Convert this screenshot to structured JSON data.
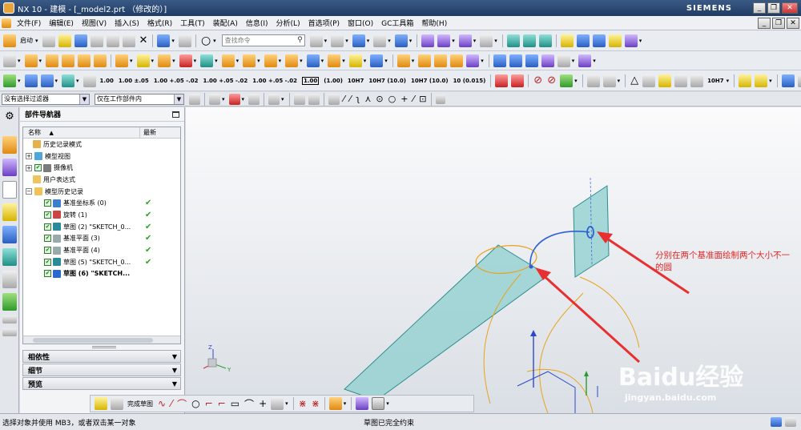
{
  "window": {
    "app_title": "NX 10 - 建模 - [_model2.prt （修改的）]",
    "brand": "SIEMENS",
    "buttons": [
      "_",
      "❐",
      "✕"
    ]
  },
  "menu": {
    "items": [
      "文件(F)",
      "编辑(E)",
      "视图(V)",
      "插入(S)",
      "格式(R)",
      "工具(T)",
      "装配(A)",
      "信息(I)",
      "分析(L)",
      "首选项(P)",
      "窗口(O)",
      "GC工具箱",
      "帮助(H)"
    ]
  },
  "toolbar": {
    "start_label": "启动",
    "search_placeholder": "查找命令",
    "dims": [
      "1.00",
      "1.00 ±.05",
      "1.00 +.05 -.02",
      "1.00 +.05 -.02",
      "1.00 +.05 -.02",
      "1.00",
      "(1.00)",
      "10H7",
      "10H7 (10.0)",
      "10H7 (10.0)",
      "10 (0.015)"
    ],
    "fit_label": "10H7"
  },
  "selection_bar": {
    "filter": "没有选择过滤器",
    "scope": "仅在工作部件内"
  },
  "navigator": {
    "title": "部件导航器",
    "col_name": "名称",
    "col_latest": "最新",
    "rows": [
      {
        "label": "历史记录模式",
        "check": false,
        "ok": false,
        "bold": false,
        "indent": 12,
        "expander": ""
      },
      {
        "label": "模型视图",
        "check": false,
        "ok": false,
        "bold": false,
        "indent": 3,
        "expander": "+"
      },
      {
        "label": "摄像机",
        "check": true,
        "ok": false,
        "bold": false,
        "indent": 3,
        "expander": "+"
      },
      {
        "label": "用户表达式",
        "check": false,
        "ok": false,
        "bold": false,
        "indent": 12,
        "expander": ""
      },
      {
        "label": "模型历史记录",
        "check": false,
        "ok": false,
        "bold": false,
        "indent": 3,
        "expander": "−"
      },
      {
        "label": "基准坐标系 (0)",
        "check": true,
        "ok": true,
        "bold": false,
        "indent": 26,
        "expander": ""
      },
      {
        "label": "旋转 (1)",
        "check": true,
        "ok": true,
        "bold": false,
        "indent": 26,
        "expander": ""
      },
      {
        "label": "草图 (2) \"SKETCH_0...",
        "check": true,
        "ok": true,
        "bold": false,
        "indent": 26,
        "expander": ""
      },
      {
        "label": "基准平面 (3)",
        "check": true,
        "ok": true,
        "bold": false,
        "indent": 26,
        "expander": ""
      },
      {
        "label": "基准平面 (4)",
        "check": true,
        "ok": true,
        "bold": false,
        "indent": 26,
        "expander": ""
      },
      {
        "label": "草图 (5) \"SKETCH_0...",
        "check": true,
        "ok": true,
        "bold": false,
        "indent": 26,
        "expander": ""
      },
      {
        "label": "草图 (6) \"SKETCH...",
        "check": true,
        "ok": false,
        "bold": true,
        "indent": 26,
        "expander": ""
      }
    ],
    "panels": [
      "相依性",
      "细节",
      "预览"
    ]
  },
  "sketch_toolbar": {
    "finish_label": "完成草图"
  },
  "annotation": {
    "text": "分别在两个基准面绘制两个大小不一的圆",
    "color": "#e02424"
  },
  "watermark": {
    "brand": "Baidu经验",
    "url": "jingyan.baidu.com"
  },
  "status": {
    "prompt": "选择对象并使用 MB3，或者双击某一对象",
    "message": "草图已完全约束"
  },
  "colors": {
    "plane_fill": "#8ecfcf",
    "plane_edge": "#2e8d8d",
    "circle": "#e8a21a",
    "arc": "#2d5fd6",
    "arrow": "#e83030",
    "axis_z": "#2d49c8",
    "axis_y": "#2e9a2e"
  }
}
